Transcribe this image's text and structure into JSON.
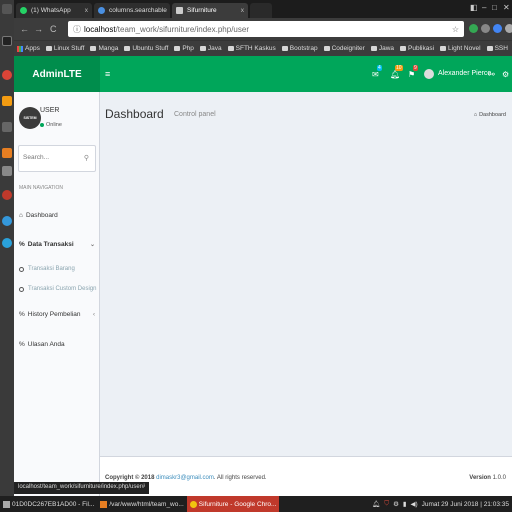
{
  "browser": {
    "tabs": [
      {
        "title": "(1) WhatsApp",
        "close": "x"
      },
      {
        "title": "columns.searchable",
        "close": "x"
      },
      {
        "title": "Sifurniture",
        "close": "x"
      }
    ],
    "url_host": "localhost",
    "url_path": "/team_work/sifurniture/index.php/user",
    "bookmarks": [
      "Apps",
      "Linux Stuff",
      "Manga",
      "Ubuntu Stuff",
      "Php",
      "Java",
      "SFTH Kaskus",
      "Bootstrap",
      "Codeigniter",
      "Jawa",
      "Publikasi",
      "Light Novel",
      "SSH"
    ],
    "bookmarks_more": "»",
    "status_url": "localhost/team_work/sifurniture/index.php/user#"
  },
  "header": {
    "logo": "AdminLTE",
    "menu_toggle": "≡",
    "badges": {
      "messages": "4",
      "notifications": "10",
      "tasks": "9"
    },
    "user_name": "Alexander Pierce"
  },
  "sidebar": {
    "avatar_text": "SISTEM",
    "user": "USER",
    "status": "Online",
    "search_placeholder": "Search...",
    "nav_header": "MAIN NAVIGATION",
    "items": {
      "dashboard": "Dashboard",
      "data_transaksi": "Data Transaksi",
      "transaksi_barang": "Transaksi Barang",
      "transaksi_custom": "Transaksi Custom Design",
      "history": "History Pembelian",
      "ulasan": "Ulasan Anda"
    }
  },
  "content": {
    "title": "Dashboard",
    "subtitle": "Control panel",
    "breadcrumb": "Dashboard"
  },
  "footer": {
    "copyright_prefix": "Copyright © 2018",
    "email": "dimaskr3@gmail.com",
    "copyright_suffix": ". All rights reserved.",
    "version_label": "Version",
    "version_value": "1.0.0"
  },
  "taskbar": {
    "items": [
      "01D0DC267EB1AD00 - Fil...",
      "/var/www/html/team_wo...",
      "Sifurniture - Google Chro..."
    ],
    "clock": "Jumat 29 Juni 2018 | 21:03:35"
  },
  "colors": {
    "navbar": "#00a65a",
    "logo_bg": "#008d4c",
    "link": "#3c8dbc"
  }
}
